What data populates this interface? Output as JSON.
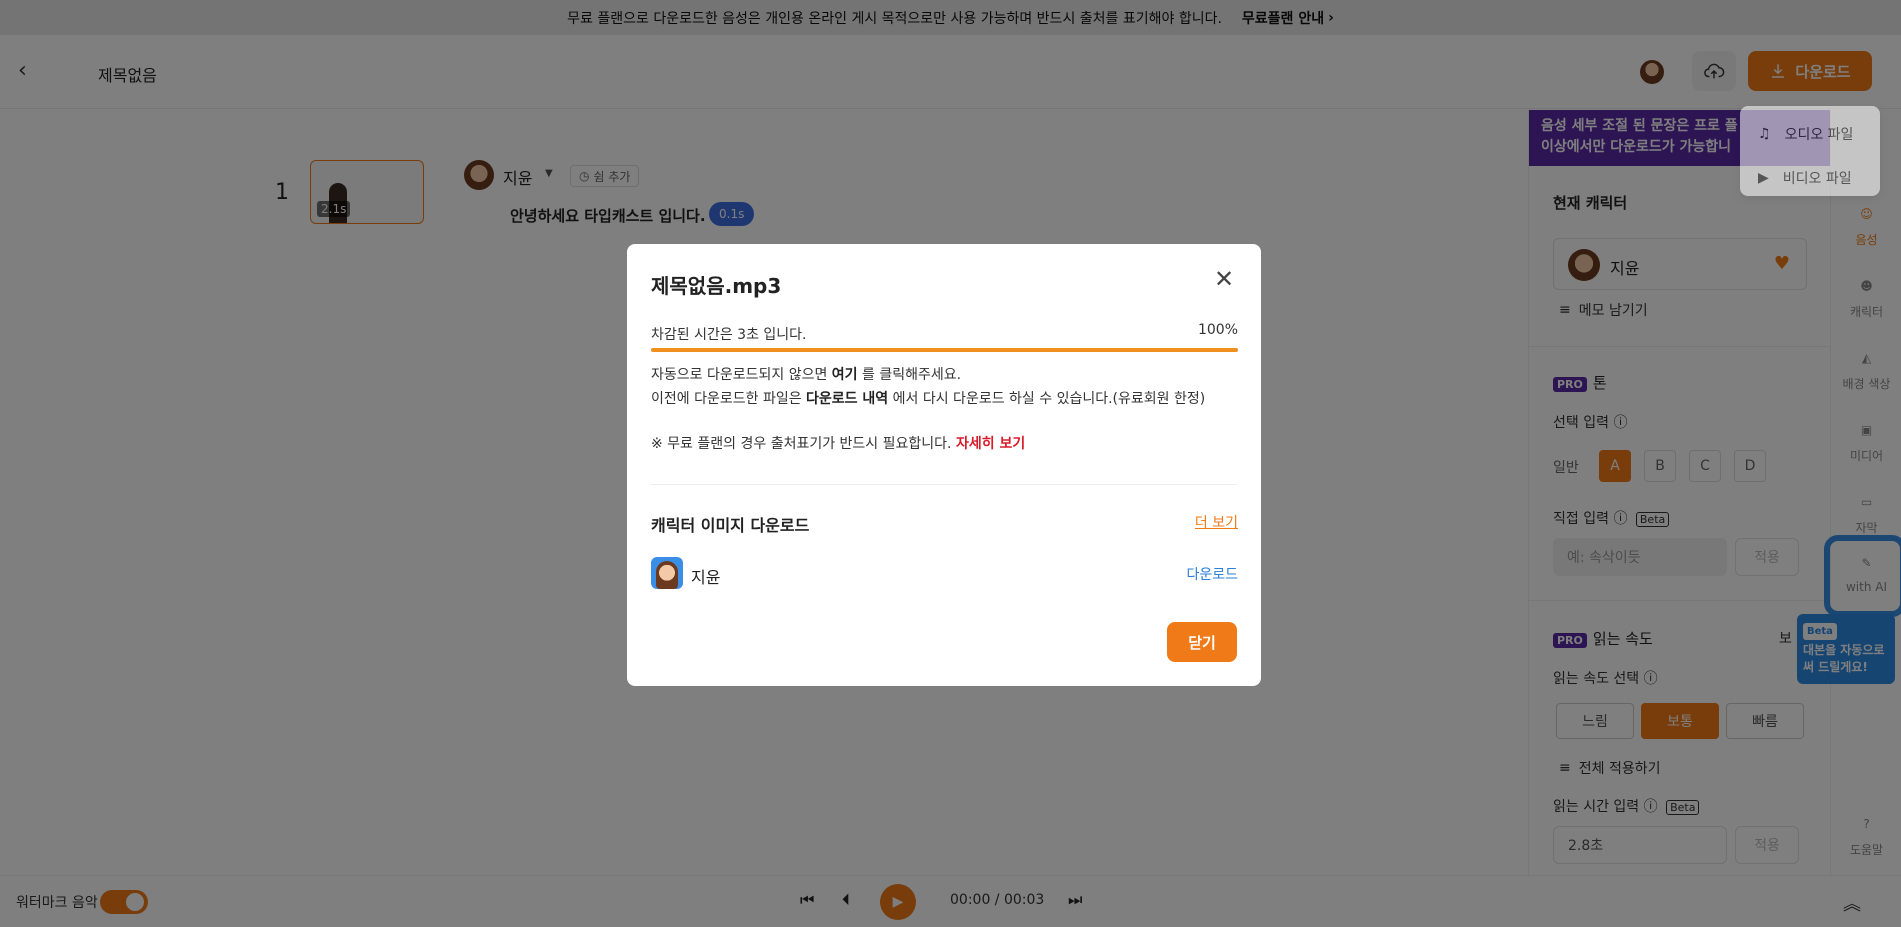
{
  "notice": {
    "text": "무료 플랜으로 다운로드한 음성은 개인용 온라인 게시 목적으로만 사용 가능하며 반드시 출처를 표기해야 합니다.",
    "link": "무료플랜 안내"
  },
  "header": {
    "title": "제목없음",
    "download_label": "다운로드"
  },
  "download_menu": {
    "items": [
      {
        "label": "오디오 파일",
        "icon": "music-note-icon"
      },
      {
        "label": "비디오 파일",
        "icon": "video-icon"
      }
    ]
  },
  "editor": {
    "scene_number": "1",
    "thumb_duration": "2.1s",
    "voice_name": "지윤",
    "pause_label": "쉼 추가",
    "script_text": "안녕하세요 타입캐스트 입니다.",
    "pause_badge": "0.1s"
  },
  "right_panel": {
    "pro_notice_line1": "음성 세부 조절 된 문장은 프로 플",
    "pro_notice_line2": "이상에서만 다운로드가 가능합니",
    "current_character_label": "현재 캐릭터",
    "character_name": "지윤",
    "memo_label": "메모 남기기",
    "pro_tag": "PRO",
    "tone_label": "톤",
    "tone_select_label": "선택 입력",
    "tone_general": "일반",
    "tone_options": [
      "A",
      "B",
      "C",
      "D"
    ],
    "tone_selected": "A",
    "direct_input_label": "직접 입력",
    "beta_tag": "Beta",
    "direct_input_placeholder": "예: 속삭이듯",
    "apply_label": "적용",
    "speed_label": "읽는 속도",
    "speed_right_fragment": "보",
    "speed_select_label": "읽는 속도 선택",
    "speed_options": [
      "느림",
      "보통",
      "빠름"
    ],
    "speed_selected": "보통",
    "apply_all_label": "전체 적용하기",
    "read_time_label": "읽는 시간 입력",
    "read_time_value": "2.8초"
  },
  "tools": [
    {
      "label": "음성",
      "icon": "voice-icon",
      "active": true
    },
    {
      "label": "캐릭터",
      "icon": "character-icon",
      "active": false
    },
    {
      "label": "배경 색상",
      "icon": "paint-bucket-icon",
      "active": false
    },
    {
      "label": "미디어",
      "icon": "media-icon",
      "active": false
    },
    {
      "label": "자막",
      "icon": "caption-icon",
      "active": false
    },
    {
      "label": "with AI",
      "icon": "ai-pen-icon",
      "active": false
    },
    {
      "label": "도움말",
      "icon": "help-icon",
      "active": false
    }
  ],
  "ai_tip": {
    "badge": "Beta",
    "line1": "대본을 자동으로",
    "line2": "써 드릴게요!"
  },
  "player": {
    "watermark_label": "워터마크 음악",
    "time": "00:00 / 00:03"
  },
  "modal": {
    "title": "제목없음.mp3",
    "remaining_text": "차감된 시간은 3초 입니다.",
    "progress_percent": 100,
    "progress_label": "100%",
    "line1_before": "자동으로 다운로드되지 않으면 ",
    "line1_bold": "여기",
    "line1_after": " 를 클릭해주세요.",
    "line2_before": "이전에 다운로드한 파일은 ",
    "line2_bold": "다운로드 내역",
    "line2_after": " 에서 다시 다운로드 하실 수 있습니다.(유료회원 한정)",
    "line3_before": "※ 무료 플랜의 경우 출처표기가 반드시 필요합니다. ",
    "line3_link": "자세히 보기",
    "section_title": "캐릭터 이미지 다운로드",
    "more_label": "더 보기",
    "character_name": "지윤",
    "character_download": "다운로드",
    "close_label": "닫기"
  }
}
